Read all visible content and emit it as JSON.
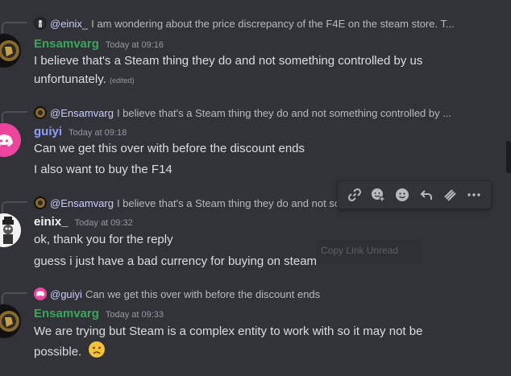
{
  "colors": {
    "background": "#313338",
    "ensamvarg": "#3ba55c",
    "guiyi": "#8c9eff",
    "einix": "#f2f3f5",
    "mention": "#c9cdfb",
    "discord_pink": "#eb459e"
  },
  "messages": [
    {
      "reply": {
        "mention": "@einix_",
        "text": "I am wondering about the price discrepancy of the F4E on the steam store. T..."
      },
      "author": "Ensamvarg",
      "timestamp": "Today at 09:16",
      "lines": [
        "I believe that's a Steam thing they do and not something controlled by us",
        "unfortunately."
      ],
      "edited": "(edited)"
    },
    {
      "reply": {
        "mention": "@Ensamvarg",
        "text": "I believe that's a Steam thing they do and not something controlled by ..."
      },
      "author": "guiyi",
      "timestamp": "Today at 09:18",
      "lines": [
        "Can we get this over with before the discount ends",
        "I also want to buy the F14"
      ]
    },
    {
      "reply": {
        "mention": "@Ensamvarg",
        "text": "I believe that's a Steam thing they do and not something controlled by ..."
      },
      "author": "einix_",
      "timestamp": "Today at 09:32",
      "lines": [
        "ok, thank you for the reply",
        "guess i just have a bad currency for buying on steam"
      ]
    },
    {
      "reply": {
        "mention": "@guiyi",
        "text": "Can we get this over with before the discount ends"
      },
      "author": "Ensamvarg",
      "timestamp": "Today at 09:33",
      "lines": [
        "We are trying but Steam is a complex entity to work with so it may not be",
        "possible."
      ],
      "emoji": "slightly-frowning-face"
    }
  ],
  "toolbar": {
    "icons": [
      "link-icon",
      "reply-thread-icon",
      "emoji-icon",
      "reply-icon",
      "app-icon",
      "more-icon"
    ]
  },
  "ghost_tooltip": "Copy Link Unread"
}
